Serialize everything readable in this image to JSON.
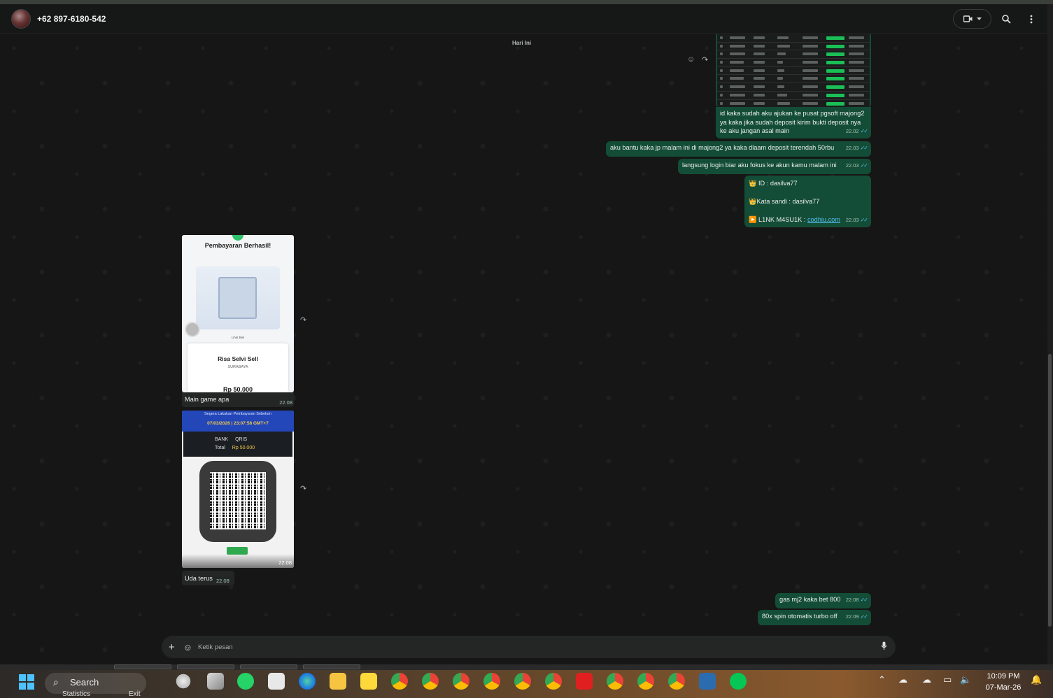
{
  "header": {
    "contact": "+62 897-6180-542"
  },
  "chat": {
    "day_label": "Hari Ini",
    "outgoing": [
      {
        "text": "id kaka sudah aku ajukan ke pusat pgsoft majong2 ya kaka jika sudah deposit kirim bukti deposit nya ke aku jangan asal main",
        "time": "22.02"
      },
      {
        "text": "aku bantu kaka jp malam ini di majong2 ya kaka dlaam deposit terendah 50rbu",
        "time": "22.03"
      },
      {
        "text": "langsung login biar aku fokus ke akun kamu malam ini",
        "time": "22.03"
      },
      {
        "line1": "👑 ID :  dasilva77",
        "line2": "👑Kata sandi : dasilva77",
        "line3_prefix": "▶️ L1NK M4SU1K : ",
        "line3_link": "codhiu.com",
        "time": "22.03"
      },
      {
        "text": "gas mj2 kaka bet 800",
        "time": "22.08"
      },
      {
        "text": "80x spin otomatis turbo off",
        "time": "22.09"
      }
    ],
    "incoming": [
      {
        "caption": "Main game apa",
        "time": "22.08",
        "image": {
          "title": "Pembayaran Berhasil!",
          "see_more": "Lihat Beli",
          "name": "Risa Selvi Sell",
          "city": "SURABAYA",
          "amount": "Rp 50.000"
        }
      },
      {
        "time": "22.08",
        "image": {
          "banner": "Segera Lakukan Pembayaran Sebelum",
          "deadline": "07/03/2026 | 23:07:58 GMT+7",
          "bank_label": "BANK",
          "bank_value": "QRIS",
          "total_label": "Total",
          "total_value": "Rp 50.000"
        }
      },
      {
        "caption": "Uda terus",
        "time": "22.08"
      }
    ]
  },
  "input": {
    "placeholder": "Ketik pesan"
  },
  "taskbar": {
    "search_label": "Search",
    "stats_label": "Statistics",
    "exit_label": "Exit",
    "time": "10:09 PM",
    "date": "07-Mar-26"
  }
}
